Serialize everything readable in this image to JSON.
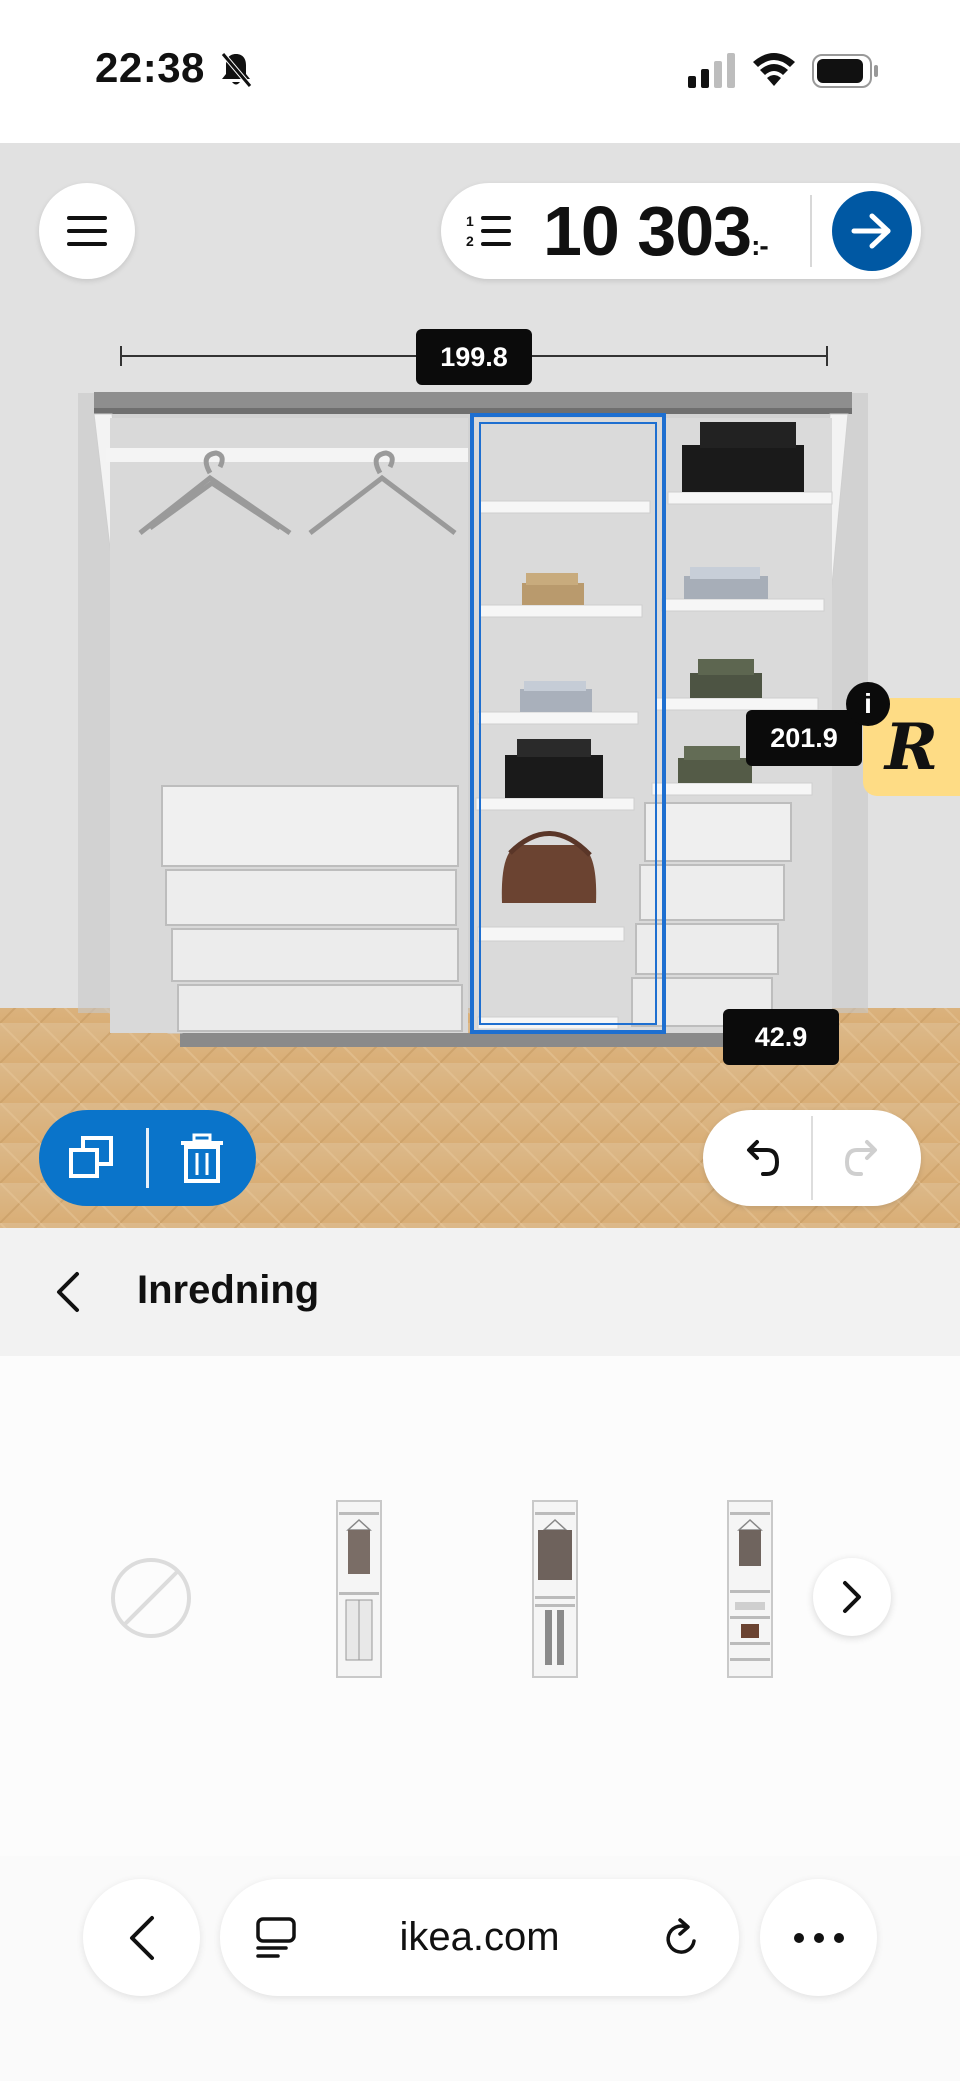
{
  "status_bar": {
    "time": "22:38",
    "icons": [
      "bell-slash-icon",
      "cellular-signal-icon",
      "wifi-icon",
      "battery-icon"
    ]
  },
  "configurator": {
    "price": "10 303",
    "price_suffix": ":-",
    "dimensions": {
      "width": "199.8",
      "height": "201.9",
      "depth": "42.9"
    },
    "badge_letter": "R",
    "badge_info": "i",
    "colors": {
      "primary_blue": "#0058a3",
      "action_blue": "#0a74ca",
      "badge_yellow": "#fedc85",
      "selection_outline": "#1e6fd0"
    }
  },
  "section": {
    "title": "Inredning"
  },
  "options": {
    "items": [
      {
        "name": "none",
        "icon": "no-option-icon"
      },
      {
        "name": "interior-1"
      },
      {
        "name": "interior-2"
      },
      {
        "name": "interior-3"
      }
    ]
  },
  "browser": {
    "url": "ikea.com"
  }
}
